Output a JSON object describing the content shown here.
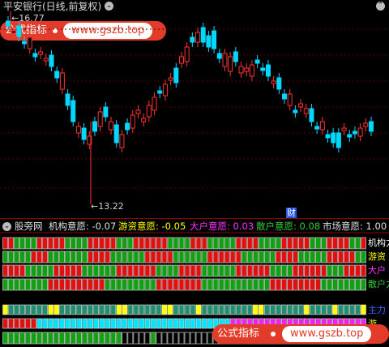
{
  "header": {
    "title": "平安银行(日线,前复权)",
    "high_label": "16.77",
    "low_label": "13.22",
    "event_marker": "财"
  },
  "watermark": {
    "badge": "公式指标",
    "url": "www.gszb.top"
  },
  "indicator": {
    "name": "股旁网",
    "items": [
      {
        "label": "机构意愿:",
        "value": "-0.07",
        "color": "#e0e0e0"
      },
      {
        "label": "游资意愿:",
        "value": "-0.05",
        "color": "#ffff00"
      },
      {
        "label": "大户意愿:",
        "value": "0.03",
        "color": "#ff33ff"
      },
      {
        "label": "散户意愿:",
        "value": "0.08",
        "color": "#33cc33"
      },
      {
        "label": "市场意愿:",
        "value": "1.00",
        "color": "#e0e0e0"
      }
    ],
    "right_labels": [
      {
        "text": "机构力",
        "color": "#ffffff"
      },
      {
        "text": "游资",
        "color": "#ffff00"
      },
      {
        "text": "大户",
        "color": "#ff33ff"
      },
      {
        "text": "散户力",
        "color": "#33cc33"
      },
      {
        "text": "主力",
        "color": "#3366ff"
      },
      {
        "text": "游",
        "color": "#ffff00"
      },
      {
        "text": "散",
        "color": "#33cc33"
      }
    ]
  },
  "colors": {
    "up": "#ff3232",
    "down": "#00d8ff",
    "red_cell": "#e01010",
    "green_cell": "#11a011",
    "teal_cell": "#1f8f6f",
    "yellow_cell": "#ffff00",
    "cyan_cell": "#00e5ff",
    "magenta_cell": "#ee22ee"
  }
}
